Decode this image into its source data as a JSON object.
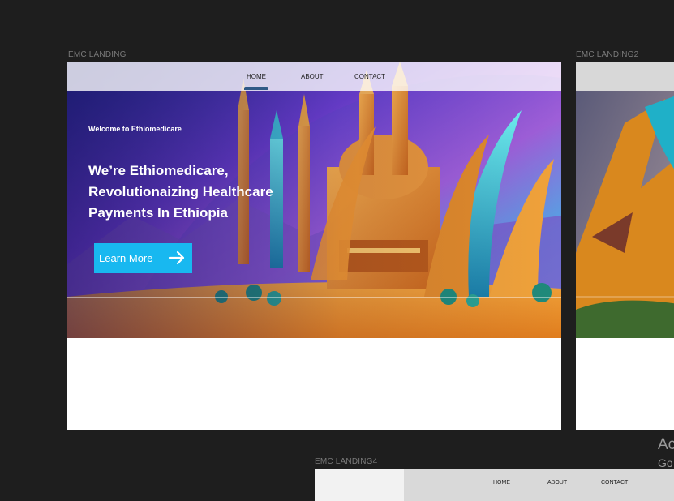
{
  "frames": {
    "landing1": {
      "label": "EMC LANDING",
      "nav": [
        "HOME",
        "ABOUT",
        "CONTACT"
      ],
      "welcome": "Welcome to Ethiomedicare",
      "headline_lines": [
        "We’re Ethiomedicare,",
        "Revolutionaizing Healthcare",
        "Payments In Ethiopia"
      ],
      "cta_label": "Learn More"
    },
    "landing2": {
      "label": "EMC LANDING2"
    },
    "landing4": {
      "label": "EMC LANDING4",
      "nav": [
        "HOME",
        "ABOUT",
        "CONTACT"
      ]
    }
  },
  "side_text": {
    "line1": "Ac",
    "line2": "Go"
  },
  "colors": {
    "canvas": "#1e1e1e",
    "cta": "#18b8f0",
    "nav_underline": "#2f5a86"
  }
}
